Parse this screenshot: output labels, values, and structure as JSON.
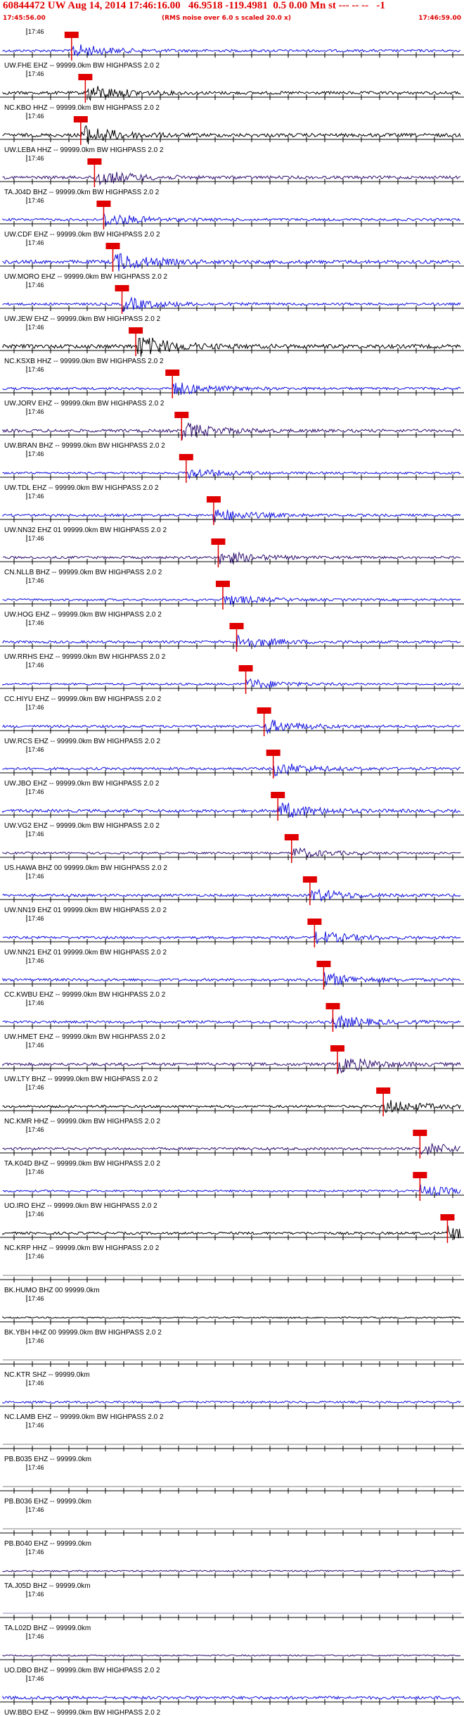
{
  "header": {
    "title": "60844472 UW Aug 14, 2014 17:46:16.00   46.9518 -119.4981  0.5 0.00 Mn st --- -- --   -1",
    "start_time": "17:45:56.00",
    "center_note": "(RMS noise over 6.0 s scaled 20.0 x)",
    "end_time": "17:46:59.00"
  },
  "colors": {
    "header": "#e00000",
    "blue": "#1010e0",
    "black": "#000000",
    "purple": "#301070",
    "pick": "#e00000"
  },
  "chart_data": {
    "type": "line",
    "title": "60844472 UW Aug 14, 2014 17:46:16.00   46.9518 -119.4981  0.5 0.00 Mn st --- -- --   -1",
    "x_start": "17:45:56.00",
    "x_end": "17:46:59.00",
    "minute_tick_label": "17:46",
    "traces": [
      {
        "label": "UW.FHE EHZ -- 99999.0km BW HIGHPASS 2.0 2",
        "color": "blue",
        "amp": 0.25,
        "pick": 0.15
      },
      {
        "label": "NC.KBO HHZ -- 99999.0km BW HIGHPASS 2.0 2",
        "color": "black",
        "amp": 0.3,
        "pick": 0.18
      },
      {
        "label": "UW.LEBA HHZ -- 99999.0km BW HIGHPASS 2.0 2",
        "color": "black",
        "amp": 0.35,
        "pick": 0.17
      },
      {
        "label": "TA.J04D BHZ -- 99999.0km BW HIGHPASS 2.0 2",
        "color": "purple",
        "amp": 0.3,
        "pick": 0.2
      },
      {
        "label": "UW.CDF EHZ -- 99999.0km BW HIGHPASS 2.0 2",
        "color": "blue",
        "amp": 0.25,
        "pick": 0.22
      },
      {
        "label": "UW.MORO EHZ -- 99999.0km BW HIGHPASS 2.0 2",
        "color": "blue",
        "amp": 0.35,
        "pick": 0.24
      },
      {
        "label": "UW.JEW EHZ -- 99999.0km BW HIGHPASS 2.0 2",
        "color": "blue",
        "amp": 0.25,
        "pick": 0.26
      },
      {
        "label": "NC.KSXB HHZ -- 99999.0km BW HIGHPASS 2.0 2",
        "color": "black",
        "amp": 0.4,
        "pick": 0.29
      },
      {
        "label": "UW.JORV EHZ -- 99999.0km BW HIGHPASS 2.0 2",
        "color": "blue",
        "amp": 0.25,
        "pick": 0.37
      },
      {
        "label": "UW.BRAN BHZ -- 99999.0km BW HIGHPASS 2.0 2",
        "color": "purple",
        "amp": 0.3,
        "pick": 0.39
      },
      {
        "label": "UW.TDL EHZ -- 99999.0km BW HIGHPASS 2.0 2",
        "color": "blue",
        "amp": 0.2,
        "pick": 0.4
      },
      {
        "label": "UW.NN32 EHZ 01 99999.0km BW HIGHPASS 2.0 2",
        "color": "blue",
        "amp": 0.25,
        "pick": 0.46
      },
      {
        "label": "CN.NLLB BHZ -- 99999.0km BW HIGHPASS 2.0 2",
        "color": "purple",
        "amp": 0.25,
        "pick": 0.47
      },
      {
        "label": "UW.HOG EHZ -- 99999.0km BW HIGHPASS 2.0 2",
        "color": "blue",
        "amp": 0.2,
        "pick": 0.48
      },
      {
        "label": "UW.RRHS EHZ -- 99999.0km BW HIGHPASS 2.0 2",
        "color": "blue",
        "amp": 0.25,
        "pick": 0.51
      },
      {
        "label": "CC.HIYU EHZ -- 99999.0km BW HIGHPASS 2.0 2",
        "color": "blue",
        "amp": 0.2,
        "pick": 0.53
      },
      {
        "label": "UW.RCS EHZ -- 99999.0km BW HIGHPASS 2.0 2",
        "color": "blue",
        "amp": 0.25,
        "pick": 0.57
      },
      {
        "label": "UW.JBO EHZ -- 99999.0km BW HIGHPASS 2.0 2",
        "color": "blue",
        "amp": 0.25,
        "pick": 0.59
      },
      {
        "label": "UW.VG2 EHZ -- 99999.0km BW HIGHPASS 2.0 2",
        "color": "blue",
        "amp": 0.3,
        "pick": 0.6
      },
      {
        "label": "US.HAWA BHZ 00 99999.0km BW HIGHPASS 2.0 2",
        "color": "purple",
        "amp": 0.2,
        "pick": 0.63
      },
      {
        "label": "UW.NN19 EHZ 01 99999.0km BW HIGHPASS 2.0 2",
        "color": "blue",
        "amp": 0.25,
        "pick": 0.67
      },
      {
        "label": "UW.NN21 EHZ 01 99999.0km BW HIGHPASS 2.0 2",
        "color": "blue",
        "amp": 0.25,
        "pick": 0.68
      },
      {
        "label": "CC.KWBU EHZ -- 99999.0km BW HIGHPASS 2.0 2",
        "color": "blue",
        "amp": 0.25,
        "pick": 0.7
      },
      {
        "label": "UW.HMET EHZ -- 99999.0km BW HIGHPASS 2.0 2",
        "color": "blue",
        "amp": 0.25,
        "pick": 0.72
      },
      {
        "label": "UW.LTY BHZ -- 99999.0km BW HIGHPASS 2.0 2",
        "color": "purple",
        "amp": 0.3,
        "pick": 0.73
      },
      {
        "label": "NC.KMR HHZ -- 99999.0km BW HIGHPASS 2.0 2",
        "color": "black",
        "amp": 0.25,
        "pick": 0.83
      },
      {
        "label": "TA.K04D BHZ -- 99999.0km BW HIGHPASS 2.0 2",
        "color": "purple",
        "amp": 0.25,
        "pick": 0.91
      },
      {
        "label": "UO.IRO EHZ -- 99999.0km BW HIGHPASS 2.0 2",
        "color": "blue",
        "amp": 0.2,
        "pick": 0.91
      },
      {
        "label": "NC.KRP HHZ -- 99999.0km BW HIGHPASS 2.0 2",
        "color": "black",
        "amp": 0.25,
        "pick": 0.97
      },
      {
        "label": "BK.HUMO BHZ 00 99999.0km",
        "color": "black",
        "amp": 0.0,
        "pick": null
      },
      {
        "label": "BK.YBH HHZ 00 99999.0km BW HIGHPASS 2.0 2",
        "color": "black",
        "amp": 0.15,
        "pick": null
      },
      {
        "label": "NC.KTR SHZ -- 99999.0km",
        "color": "black",
        "amp": 0.0,
        "pick": null
      },
      {
        "label": "NC.LAMB EHZ -- 99999.0km BW HIGHPASS 2.0 2",
        "color": "blue",
        "amp": 0.2,
        "pick": null
      },
      {
        "label": "PB.B035 EHZ -- 99999.0km",
        "color": "black",
        "amp": 0.0,
        "pick": null
      },
      {
        "label": "PB.B036 EHZ -- 99999.0km",
        "color": "black",
        "amp": 0.0,
        "pick": null
      },
      {
        "label": "PB.B040 EHZ -- 99999.0km",
        "color": "black",
        "amp": 0.0,
        "pick": null
      },
      {
        "label": "TA.J05D BHZ -- 99999.0km",
        "color": "purple",
        "amp": 0.15,
        "pick": null
      },
      {
        "label": "TA.L02D BHZ -- 99999.0km",
        "color": "purple",
        "amp": 0.0,
        "pick": null
      },
      {
        "label": "UO.DBO BHZ -- 99999.0km BW HIGHPASS 2.0 2",
        "color": "purple",
        "amp": 0.15,
        "pick": null
      },
      {
        "label": "UW.BBO EHZ -- 99999.0km BW HIGHPASS 2.0 2",
        "color": "blue",
        "amp": 0.3,
        "pick": null
      }
    ]
  }
}
